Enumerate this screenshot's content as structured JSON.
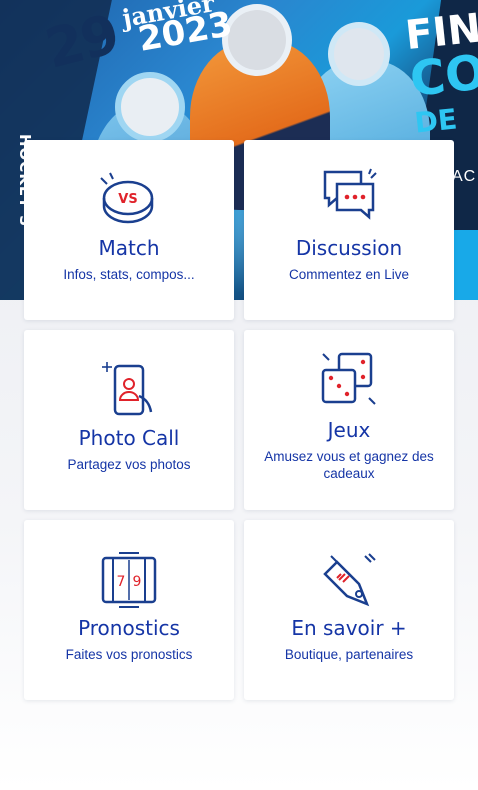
{
  "banner": {
    "date_day": "29",
    "date_month": "janvier",
    "date_year": "2023",
    "headline_line1": "FIN",
    "headline_line2": "CO",
    "headline_line3": "DE",
    "side_text": "HOCKEY S",
    "right_small": "AC"
  },
  "colors": {
    "accent": "#1535a6",
    "icon_red": "#e0222a",
    "icon_navy": "#1a3f8f"
  },
  "cards": [
    {
      "title": "Match",
      "subtitle": "Infos, stats, compos...",
      "icon": "vs-puck-icon",
      "icon_text": "VS"
    },
    {
      "title": "Discussion",
      "subtitle": "Commentez en Live",
      "icon": "chat-bubbles-icon"
    },
    {
      "title": "Photo Call",
      "subtitle": "Partagez vos photos",
      "icon": "selfie-phone-icon"
    },
    {
      "title": "Jeux",
      "subtitle": "Amusez vous et gagnez des cadeaux",
      "icon": "dice-icon"
    },
    {
      "title": "Pronostics",
      "subtitle": "Faites vos pronostics",
      "icon": "scoreboard-icon",
      "icon_digits": [
        "7",
        "9"
      ]
    },
    {
      "title": "En savoir +",
      "subtitle": "Boutique, partenaires",
      "icon": "price-tag-icon"
    }
  ]
}
